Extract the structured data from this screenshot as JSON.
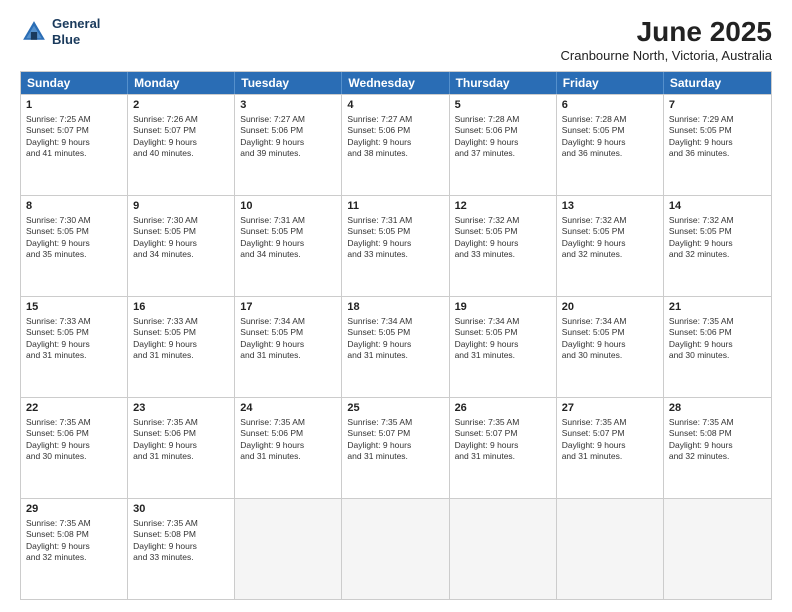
{
  "logo": {
    "line1": "General",
    "line2": "Blue"
  },
  "title": "June 2025",
  "location": "Cranbourne North, Victoria, Australia",
  "header_days": [
    "Sunday",
    "Monday",
    "Tuesday",
    "Wednesday",
    "Thursday",
    "Friday",
    "Saturday"
  ],
  "rows": [
    [
      {
        "day": "1",
        "info": "Sunrise: 7:25 AM\nSunset: 5:07 PM\nDaylight: 9 hours\nand 41 minutes."
      },
      {
        "day": "2",
        "info": "Sunrise: 7:26 AM\nSunset: 5:07 PM\nDaylight: 9 hours\nand 40 minutes."
      },
      {
        "day": "3",
        "info": "Sunrise: 7:27 AM\nSunset: 5:06 PM\nDaylight: 9 hours\nand 39 minutes."
      },
      {
        "day": "4",
        "info": "Sunrise: 7:27 AM\nSunset: 5:06 PM\nDaylight: 9 hours\nand 38 minutes."
      },
      {
        "day": "5",
        "info": "Sunrise: 7:28 AM\nSunset: 5:06 PM\nDaylight: 9 hours\nand 37 minutes."
      },
      {
        "day": "6",
        "info": "Sunrise: 7:28 AM\nSunset: 5:05 PM\nDaylight: 9 hours\nand 36 minutes."
      },
      {
        "day": "7",
        "info": "Sunrise: 7:29 AM\nSunset: 5:05 PM\nDaylight: 9 hours\nand 36 minutes."
      }
    ],
    [
      {
        "day": "8",
        "info": "Sunrise: 7:30 AM\nSunset: 5:05 PM\nDaylight: 9 hours\nand 35 minutes."
      },
      {
        "day": "9",
        "info": "Sunrise: 7:30 AM\nSunset: 5:05 PM\nDaylight: 9 hours\nand 34 minutes."
      },
      {
        "day": "10",
        "info": "Sunrise: 7:31 AM\nSunset: 5:05 PM\nDaylight: 9 hours\nand 34 minutes."
      },
      {
        "day": "11",
        "info": "Sunrise: 7:31 AM\nSunset: 5:05 PM\nDaylight: 9 hours\nand 33 minutes."
      },
      {
        "day": "12",
        "info": "Sunrise: 7:32 AM\nSunset: 5:05 PM\nDaylight: 9 hours\nand 33 minutes."
      },
      {
        "day": "13",
        "info": "Sunrise: 7:32 AM\nSunset: 5:05 PM\nDaylight: 9 hours\nand 32 minutes."
      },
      {
        "day": "14",
        "info": "Sunrise: 7:32 AM\nSunset: 5:05 PM\nDaylight: 9 hours\nand 32 minutes."
      }
    ],
    [
      {
        "day": "15",
        "info": "Sunrise: 7:33 AM\nSunset: 5:05 PM\nDaylight: 9 hours\nand 31 minutes."
      },
      {
        "day": "16",
        "info": "Sunrise: 7:33 AM\nSunset: 5:05 PM\nDaylight: 9 hours\nand 31 minutes."
      },
      {
        "day": "17",
        "info": "Sunrise: 7:34 AM\nSunset: 5:05 PM\nDaylight: 9 hours\nand 31 minutes."
      },
      {
        "day": "18",
        "info": "Sunrise: 7:34 AM\nSunset: 5:05 PM\nDaylight: 9 hours\nand 31 minutes."
      },
      {
        "day": "19",
        "info": "Sunrise: 7:34 AM\nSunset: 5:05 PM\nDaylight: 9 hours\nand 31 minutes."
      },
      {
        "day": "20",
        "info": "Sunrise: 7:34 AM\nSunset: 5:05 PM\nDaylight: 9 hours\nand 30 minutes."
      },
      {
        "day": "21",
        "info": "Sunrise: 7:35 AM\nSunset: 5:06 PM\nDaylight: 9 hours\nand 30 minutes."
      }
    ],
    [
      {
        "day": "22",
        "info": "Sunrise: 7:35 AM\nSunset: 5:06 PM\nDaylight: 9 hours\nand 30 minutes."
      },
      {
        "day": "23",
        "info": "Sunrise: 7:35 AM\nSunset: 5:06 PM\nDaylight: 9 hours\nand 31 minutes."
      },
      {
        "day": "24",
        "info": "Sunrise: 7:35 AM\nSunset: 5:06 PM\nDaylight: 9 hours\nand 31 minutes."
      },
      {
        "day": "25",
        "info": "Sunrise: 7:35 AM\nSunset: 5:07 PM\nDaylight: 9 hours\nand 31 minutes."
      },
      {
        "day": "26",
        "info": "Sunrise: 7:35 AM\nSunset: 5:07 PM\nDaylight: 9 hours\nand 31 minutes."
      },
      {
        "day": "27",
        "info": "Sunrise: 7:35 AM\nSunset: 5:07 PM\nDaylight: 9 hours\nand 31 minutes."
      },
      {
        "day": "28",
        "info": "Sunrise: 7:35 AM\nSunset: 5:08 PM\nDaylight: 9 hours\nand 32 minutes."
      }
    ],
    [
      {
        "day": "29",
        "info": "Sunrise: 7:35 AM\nSunset: 5:08 PM\nDaylight: 9 hours\nand 32 minutes."
      },
      {
        "day": "30",
        "info": "Sunrise: 7:35 AM\nSunset: 5:08 PM\nDaylight: 9 hours\nand 33 minutes."
      },
      {
        "day": "",
        "info": ""
      },
      {
        "day": "",
        "info": ""
      },
      {
        "day": "",
        "info": ""
      },
      {
        "day": "",
        "info": ""
      },
      {
        "day": "",
        "info": ""
      }
    ]
  ]
}
